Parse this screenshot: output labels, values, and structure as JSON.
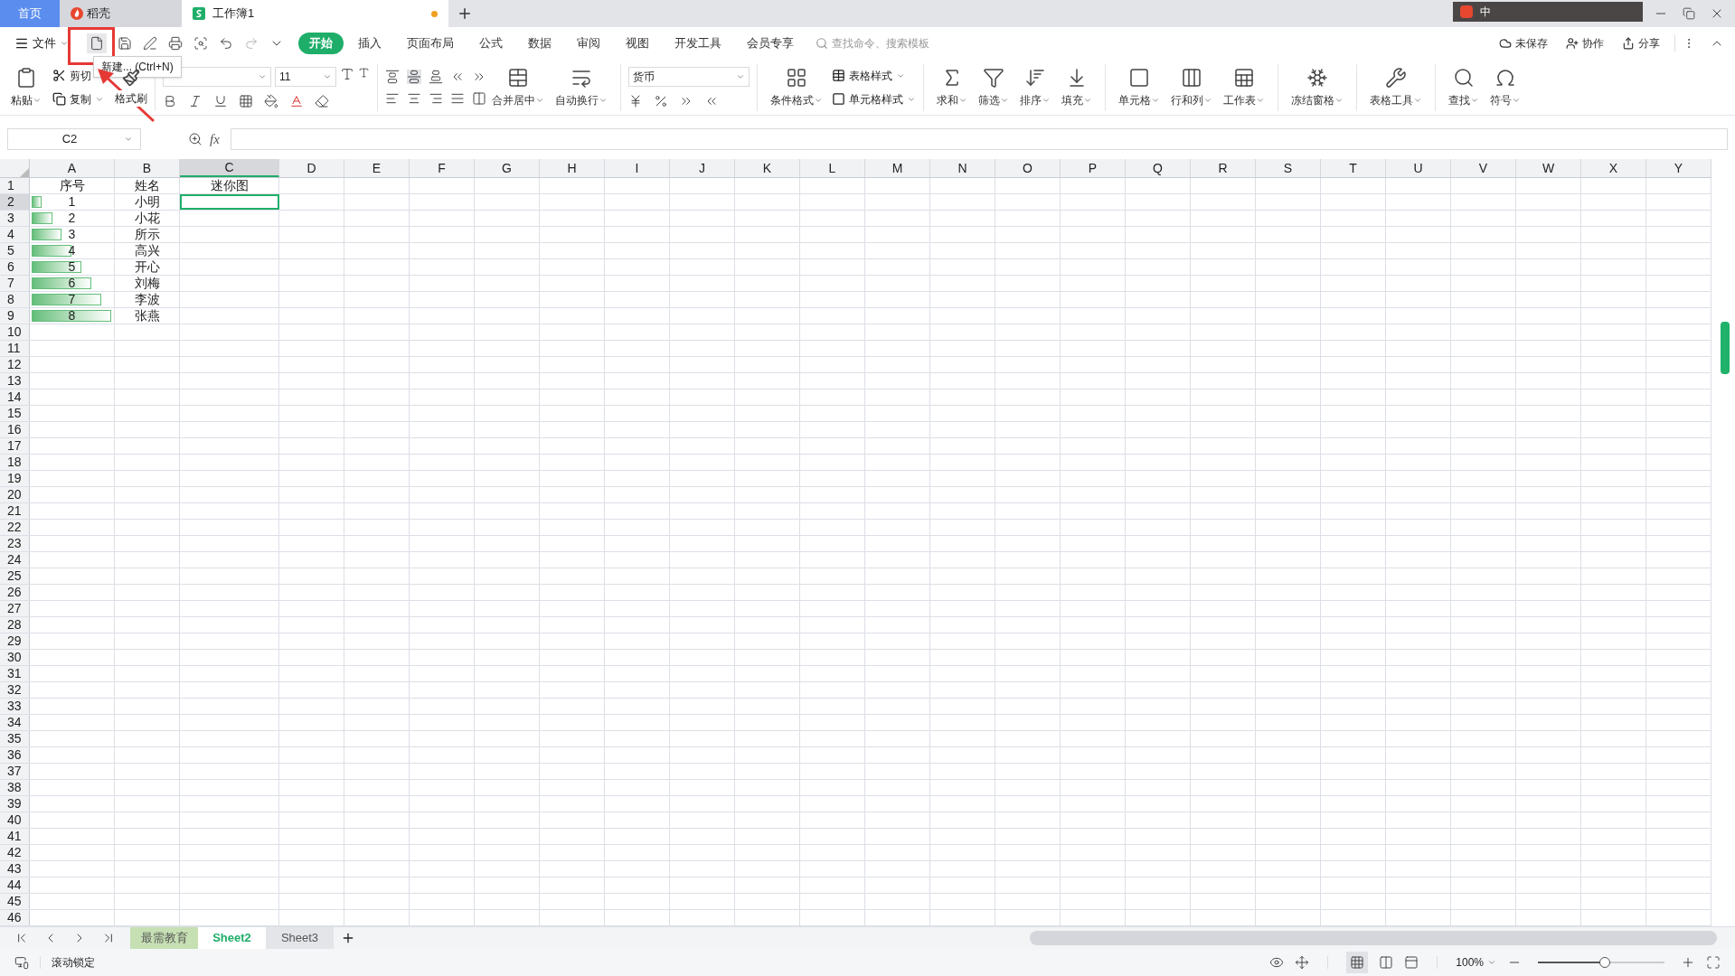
{
  "title_tabs": [
    {
      "label": "首页",
      "kind": "home",
      "selected": false
    },
    {
      "label": "稻壳",
      "kind": "docer",
      "selected": false
    },
    {
      "label": "工作簿1",
      "kind": "sheet",
      "selected": true,
      "unsaved": true
    }
  ],
  "ime": {
    "label": "中"
  },
  "menu": {
    "file": "文件",
    "tabs": [
      {
        "label": "开始",
        "selected": true
      },
      {
        "label": "插入",
        "selected": false
      },
      {
        "label": "页面布局",
        "selected": false
      },
      {
        "label": "公式",
        "selected": false
      },
      {
        "label": "数据",
        "selected": false
      },
      {
        "label": "审阅",
        "selected": false
      },
      {
        "label": "视图",
        "selected": false
      },
      {
        "label": "开发工具",
        "selected": false
      },
      {
        "label": "会员专享",
        "selected": false
      }
    ],
    "search_placeholder": "查找命令、搜索模板",
    "actions": [
      "未保存",
      "协作",
      "分享"
    ]
  },
  "tooltip": "新建... (Ctrl+N)",
  "ribbon": {
    "paste": "粘贴",
    "cut": "剪切",
    "copy": "复制",
    "format_painter": "格式刷",
    "font_size": "11",
    "merge": "合并居中",
    "wrap": "自动换行",
    "number_format": "货币",
    "conditional": "条件格式",
    "table_style": "表格样式",
    "cell_style": "单元格样式",
    "tools": [
      "求和",
      "筛选",
      "排序",
      "填充"
    ],
    "cells": [
      "单元格",
      "行和列",
      "工作表"
    ],
    "freeze": "冻结窗格",
    "table_tools": "表格工具",
    "find": [
      "查找",
      "符号"
    ]
  },
  "formula_bar": {
    "name_box": "C2",
    "fx": "fx"
  },
  "columns": [
    {
      "label": "A",
      "selected": false
    },
    {
      "label": "B",
      "selected": false
    },
    {
      "label": "C",
      "selected": true
    },
    {
      "label": "D",
      "selected": false
    },
    {
      "label": "E",
      "selected": false
    },
    {
      "label": "F",
      "selected": false
    },
    {
      "label": "G",
      "selected": false
    },
    {
      "label": "H",
      "selected": false
    },
    {
      "label": "I",
      "selected": false
    },
    {
      "label": "J",
      "selected": false
    },
    {
      "label": "K",
      "selected": false
    },
    {
      "label": "L",
      "selected": false
    },
    {
      "label": "M",
      "selected": false
    },
    {
      "label": "N",
      "selected": false
    },
    {
      "label": "O",
      "selected": false
    },
    {
      "label": "P",
      "selected": false
    },
    {
      "label": "Q",
      "selected": false
    },
    {
      "label": "R",
      "selected": false
    },
    {
      "label": "S",
      "selected": false
    },
    {
      "label": "T",
      "selected": false
    },
    {
      "label": "U",
      "selected": false
    },
    {
      "label": "V",
      "selected": false
    },
    {
      "label": "W",
      "selected": false
    },
    {
      "label": "X",
      "selected": false
    },
    {
      "label": "Y",
      "selected": false
    }
  ],
  "row_headers": [
    {
      "label": "1",
      "selected": false
    },
    {
      "label": "2",
      "selected": true
    },
    {
      "label": "3",
      "selected": false
    },
    {
      "label": "4",
      "selected": false
    },
    {
      "label": "5",
      "selected": false
    },
    {
      "label": "6",
      "selected": false
    },
    {
      "label": "7",
      "selected": false
    },
    {
      "label": "8",
      "selected": false
    },
    {
      "label": "9",
      "selected": false
    },
    {
      "label": "10",
      "selected": false
    },
    {
      "label": "11",
      "selected": false
    },
    {
      "label": "12",
      "selected": false
    },
    {
      "label": "13",
      "selected": false
    },
    {
      "label": "14",
      "selected": false
    },
    {
      "label": "15",
      "selected": false
    },
    {
      "label": "16",
      "selected": false
    },
    {
      "label": "17",
      "selected": false
    },
    {
      "label": "18",
      "selected": false
    },
    {
      "label": "19",
      "selected": false
    },
    {
      "label": "20",
      "selected": false
    },
    {
      "label": "21",
      "selected": false
    },
    {
      "label": "22",
      "selected": false
    },
    {
      "label": "23",
      "selected": false
    },
    {
      "label": "24",
      "selected": false
    },
    {
      "label": "25",
      "selected": false
    },
    {
      "label": "26",
      "selected": false
    },
    {
      "label": "27",
      "selected": false
    },
    {
      "label": "28",
      "selected": false
    },
    {
      "label": "29",
      "selected": false
    },
    {
      "label": "30",
      "selected": false
    },
    {
      "label": "31",
      "selected": false
    },
    {
      "label": "32",
      "selected": false
    },
    {
      "label": "33",
      "selected": false
    },
    {
      "label": "34",
      "selected": false
    },
    {
      "label": "35",
      "selected": false
    },
    {
      "label": "36",
      "selected": false
    },
    {
      "label": "37",
      "selected": false
    },
    {
      "label": "38",
      "selected": false
    },
    {
      "label": "39",
      "selected": false
    },
    {
      "label": "40",
      "selected": false
    },
    {
      "label": "41",
      "selected": false
    },
    {
      "label": "42",
      "selected": false
    },
    {
      "label": "43",
      "selected": false
    },
    {
      "label": "44",
      "selected": false
    },
    {
      "label": "45",
      "selected": false
    },
    {
      "label": "46",
      "selected": false
    }
  ],
  "rows": [
    {
      "a": "序号",
      "b": "姓名",
      "c": "迷你图"
    },
    {
      "a": "1",
      "level": 0.12,
      "b": "小明"
    },
    {
      "a": "2",
      "level": 0.25,
      "b": "小花"
    },
    {
      "a": "3",
      "level": 0.37,
      "b": "所示"
    },
    {
      "a": "4",
      "level": 0.49,
      "b": "高兴"
    },
    {
      "a": "5",
      "level": 0.61,
      "b": "开心"
    },
    {
      "a": "6",
      "level": 0.73,
      "b": "刘梅"
    },
    {
      "a": "7",
      "level": 0.86,
      "b": "李波"
    },
    {
      "a": "8",
      "level": 0.98,
      "b": "张燕"
    }
  ],
  "sheets": [
    {
      "label": "最需教育",
      "selected": false,
      "color": "#c6e0b4"
    },
    {
      "label": "Sheet2",
      "selected": true
    },
    {
      "label": "Sheet3",
      "selected": false
    }
  ],
  "status": {
    "scroll_lock": "滚动锁定",
    "zoom": "100%",
    "zoom_slider": {
      "level": 0.53
    }
  }
}
